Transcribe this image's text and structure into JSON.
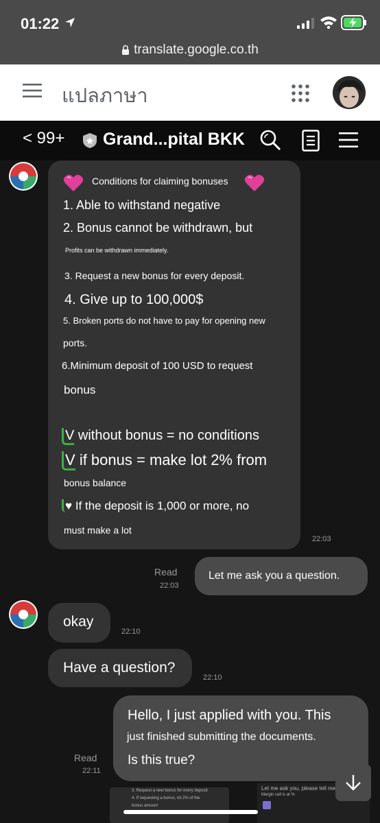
{
  "status_bar": {
    "time": "01:22"
  },
  "browser": {
    "url": "translate.google.co.th"
  },
  "translate_header": {
    "title": "แปลภาษา"
  },
  "chat_header": {
    "back_label": "< 99+",
    "title": "Grand...pital BKK"
  },
  "messages": {
    "conditions": {
      "heading": "Conditions for claiming bonuses",
      "line1": "1. Able to withstand negative",
      "line2": "2. Bonus cannot be withdrawn, but",
      "line2b": "Profits can be withdrawn immediately.",
      "line3": "3. Request a new bonus for every deposit.",
      "line4": "4. Give up to 100,000$",
      "line5": "5. Broken ports do not have to pay for opening new",
      "line5b": "ports.",
      "line6": "6.Minimum deposit of 100 USD to request",
      "line6b": "bonus",
      "v1_mark": "V",
      "v1_text": "without bonus = no conditions",
      "v2_mark": "V",
      "v2_text": "if bonus = make lot 2% from",
      "v2b": "bonus balance",
      "heart_mark": "♥",
      "heart_text": "If the deposit is 1,000 or more, no",
      "heart_b": "must make a lot",
      "time": "22:03"
    },
    "outgoing1": {
      "read": "Read",
      "time": "22:03",
      "text": "Let me ask you a question."
    },
    "okay": {
      "text": "okay",
      "time": "22:10"
    },
    "question": {
      "text": "Have a question?",
      "time": "22:10"
    },
    "outgoing2": {
      "read": "Read",
      "time": "22:11",
      "line1": "Hello, I just applied with you. This",
      "line2": "just finished submitting the documents.",
      "line3": "Is this true?"
    },
    "preview_left": {
      "line1": "3. Request a new bonus for every deposit",
      "line2": "4. If requesting a bonus, lot 2% of the",
      "line3": "bonus amount"
    },
    "preview_right": {
      "line1": "Let me ask you, please tell me.",
      "line2": "Margin call is at %"
    }
  },
  "colors": {
    "highlight": "#3cb043",
    "bubble_in": "#333333",
    "bubble_out": "#4a4a4a",
    "heart": "#e0409a"
  }
}
